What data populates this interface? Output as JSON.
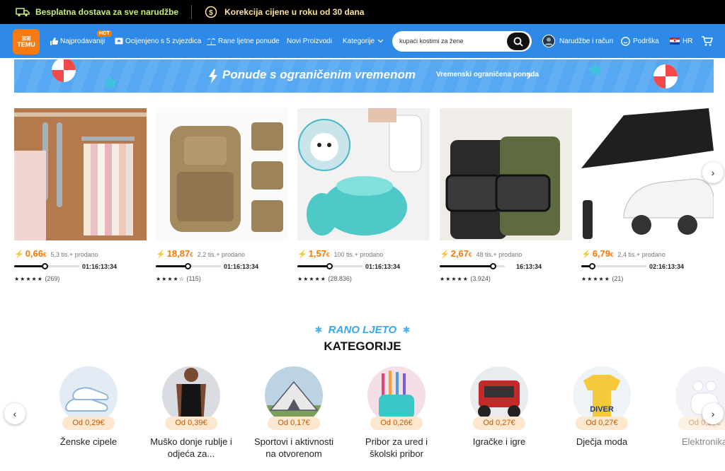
{
  "topbar": {
    "shipping_text": "Besplatna dostava za sve narudžbe",
    "price_text": "Korekcija cijene u roku od 30 dana",
    "shipping_color": "#c8f06e",
    "price_color": "#ffe39a"
  },
  "nav": {
    "logo_top": "ꕤꕤ",
    "logo_text": "TEMU",
    "bestsellers": "Najprodavaniji",
    "hot_badge": "HOT",
    "five_stars": "Ocijenjeno s 5 zvjezdica",
    "early_summer": "Rane ljetne ponude",
    "new_products": "Novi Proizvodi",
    "categories": "Kategorije",
    "search_value": "kupaći kostimi za žene",
    "orders": "Narudžbe i račun",
    "support": "Podrška",
    "language": "HR",
    "accent": "#2e8ae6",
    "brand": "#f77a12"
  },
  "banner": {
    "title": "Ponude s ograničenim vremenom",
    "link": "Vremenski ograničena ponuda"
  },
  "products": [
    {
      "price": "0,66",
      "currency": "€",
      "sold": "5,3 tis.+ prodano",
      "timer": "01:16:13:34",
      "progress": 0.47,
      "stars": "★★★★★",
      "reviews": "(269)",
      "icon": "clothes-hangers"
    },
    {
      "price": "18,87",
      "currency": "€",
      "sold": "2,2 tis.+ prodano",
      "timer": "01:16:13:34",
      "progress": 0.49,
      "stars": "★★★★☆",
      "reviews": "(115)",
      "icon": "tactical-backpack"
    },
    {
      "price": "1,57",
      "currency": "€",
      "sold": "100 tis.+ prodano",
      "timer": "01:16:13:34",
      "progress": 0.49,
      "stars": "★★★★★",
      "reviews": "(28.836)",
      "icon": "pet-bath-brush"
    },
    {
      "price": "2,67",
      "currency": "€",
      "sold": "48 tis.+ prodano",
      "timer": "16:13:34",
      "progress": 0.82,
      "stars": "★★★★★",
      "reviews": "(3.924)",
      "icon": "tactical-belts"
    },
    {
      "price": "6,79",
      "currency": "€",
      "sold": "2,4 tis.+ prodano",
      "timer": "02:16:13:34",
      "progress": 0.16,
      "stars": "★★★★★",
      "reviews": "(21)",
      "icon": "car-sun-umbrella"
    }
  ],
  "section": {
    "kicker": "RANO LJETO",
    "title": "KATEGORIJE"
  },
  "categories": [
    {
      "price": "Od 0,29€",
      "label": "Ženske cipele"
    },
    {
      "price": "Od 0,39€",
      "label": "Muško donje rublje i odjeća za..."
    },
    {
      "price": "Od 0,17€",
      "label": "Sportovi i aktivnosti na otvorenom"
    },
    {
      "price": "Od 0,26€",
      "label": "Pribor za ured i školski pribor"
    },
    {
      "price": "Od 0,27€",
      "label": "Igračke i igre"
    },
    {
      "price": "Od 0,27€",
      "label": "Dječja moda"
    },
    {
      "price": "Od 0,29€",
      "label": "Elektronika"
    }
  ]
}
